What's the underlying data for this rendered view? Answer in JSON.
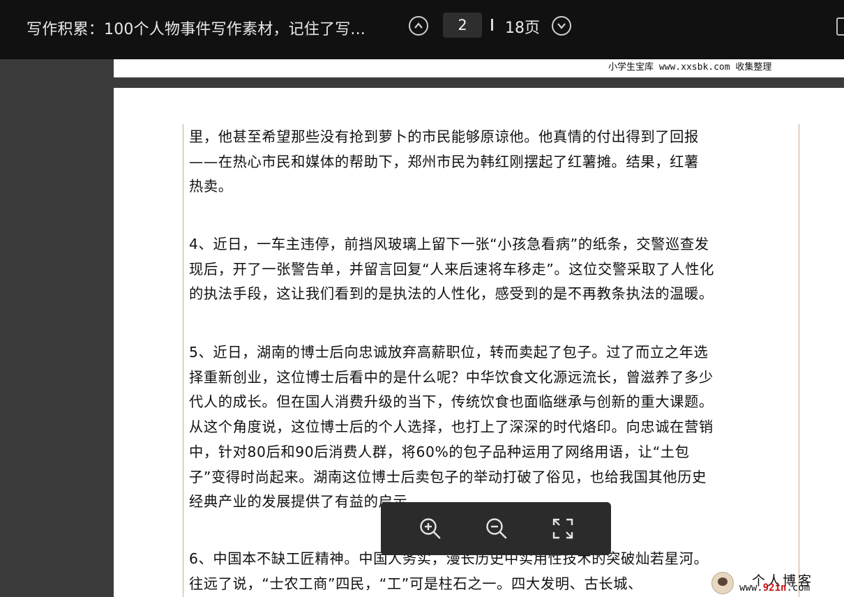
{
  "viewer": {
    "title": "写作积累：100个人物事件写作素材，记住了写...",
    "current_page": "2",
    "total_pages": "18页"
  },
  "prev_page_footer": "小学生宝库 www.xxsbk.com 收集整理",
  "content": {
    "p1": [
      "里，他甚至希望那些没有抢到萝卜的市民能够原谅他。他真情的付出得到了回报",
      "——在热心市民和媒体的帮助下，郑州市民为韩红刚摆起了红薯摊。结果，红薯",
      "热卖。"
    ],
    "p4": [
      "4、近日，一车主违停，前挡风玻璃上留下一张“小孩急看病”的纸条，交警巡查发",
      "现后，开了一张警告单，并留言回复“人来后速将车移走”。这位交警采取了人性化",
      "的执法手段，这让我们看到的是执法的人性化，感受到的是不再教条执法的温暖。"
    ],
    "p5": [
      "5、近日，湖南的博士后向忠诚放弃高薪职位，转而卖起了包子。过了而立之年选",
      "择重新创业，这位博士后看中的是什么呢？中华饮食文化源远流长，曾滋养了多少",
      "代人的成长。但在国人消费升级的当下，传统饮食也面临继承与创新的重大课题。",
      "从这个角度说，这位博士后的个人选择，也打上了深深的时代烙印。向忠诚在营销",
      "中，针对80后和90后消费人群，将60%的包子品种运用了网络用语，让“土包",
      "子”变得时尚起来。湖南这位博士后卖包子的举动打破了俗见，也给我国其他历史",
      "经典产业的发展提供了有益的启示。"
    ],
    "p6": [
      "6、中国本不缺工匠精神。中国人务实，漫长历史中实用性技术的突破灿若星河。",
      "往远了说，“士农工商”四民，“工”可是柱石之一。四大发明、古长城、"
    ]
  },
  "zoom_toolbar": {
    "zoom_in_icon": "zoom-in-icon",
    "zoom_out_icon": "zoom-out-icon",
    "fullscreen_icon": "fullscreen-icon"
  },
  "watermark": {
    "name": "个人博客",
    "url_prefix": "www.",
    "url_brand": "92in",
    "url_suffix": ".com"
  },
  "colors": {
    "topbar": "#111111",
    "page_bg": "#ffffff",
    "margin_line": "#c9a98a"
  }
}
